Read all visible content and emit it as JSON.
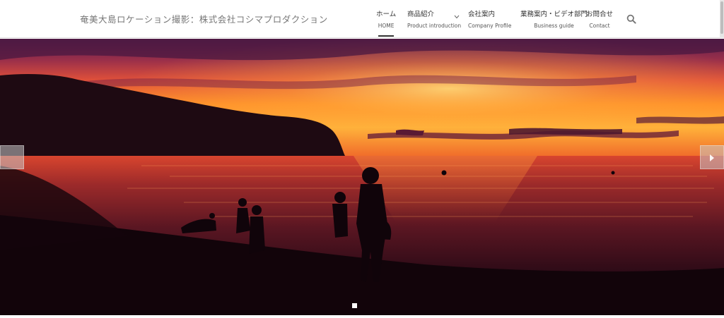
{
  "header": {
    "site_title": "奄美大島ロケーション撮影：株式会社コシマプロダクション",
    "nav": [
      {
        "jp": "ホーム",
        "en": "HOME"
      },
      {
        "jp": "商品紹介",
        "en": "Product introduction"
      },
      {
        "jp": "会社案内",
        "en": "Company Profile"
      },
      {
        "jp": "業務案内・ビデオ部門",
        "en": "Business guide"
      },
      {
        "jp": "お問合せ",
        "en": "Contact"
      }
    ],
    "search_icon": "search-icon",
    "dropdown_icon": "chevron-down-icon"
  },
  "slider": {
    "prev_icon": "chevron-left-icon",
    "next_icon": "chevron-right-icon",
    "active_slide_indicator": "slide-dot"
  },
  "colors": {
    "header_bg": "#ffffff",
    "nav_text": "#333333",
    "sky_top": "#6a2a5c",
    "sunset_orange": "#ff8a1e",
    "sea_dark": "#1a0712"
  }
}
